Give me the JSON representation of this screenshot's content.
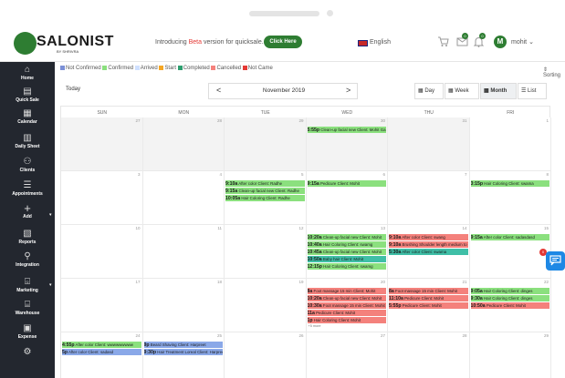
{
  "header": {
    "logo": "SALONIST",
    "logo_sub": "BY SHRIVRA",
    "intro_pre": "Introducing ",
    "intro_beta": "Beta",
    "intro_post": " version for quicksale.",
    "click_here": "Click Here",
    "language": "English",
    "notif_badge_1": "0",
    "notif_badge_2": "0",
    "avatar_letter": "M",
    "user_name": "mohit"
  },
  "sidebar": {
    "items": [
      {
        "label": "Home",
        "icon": "home-icon",
        "glyph": "⌂"
      },
      {
        "label": "Quick Sale",
        "icon": "register-icon",
        "glyph": "▤"
      },
      {
        "label": "Calendar",
        "icon": "calendar-icon",
        "glyph": "▦"
      },
      {
        "label": "Daily Sheet",
        "icon": "sheet-icon",
        "glyph": "▥"
      },
      {
        "label": "Clients",
        "icon": "clients-icon",
        "glyph": "⚇"
      },
      {
        "label": "Appointments",
        "icon": "list-icon",
        "glyph": "☰"
      },
      {
        "label": "Add",
        "icon": "plus-icon",
        "glyph": "+"
      },
      {
        "label": "Reports",
        "icon": "report-icon",
        "glyph": "▧"
      },
      {
        "label": "Integration",
        "icon": "integration-icon",
        "glyph": "⚲"
      },
      {
        "label": "Marketing",
        "icon": "marketing-icon",
        "glyph": "⌺"
      },
      {
        "label": "Warehouse",
        "icon": "warehouse-icon",
        "glyph": "⌸"
      },
      {
        "label": "Expense",
        "icon": "expense-icon",
        "glyph": "▣"
      },
      {
        "label": "",
        "icon": "settings-icon",
        "glyph": "⚙"
      }
    ]
  },
  "legend": {
    "items": [
      {
        "label": "Not Confirmed",
        "color": "#7b8fd6"
      },
      {
        "label": "Confirmed",
        "color": "#8be07e"
      },
      {
        "label": "Arrived",
        "color": "#cfe0ff"
      },
      {
        "label": "Start",
        "color": "#f5a623"
      },
      {
        "label": "Completed",
        "color": "#2e9e6f"
      },
      {
        "label": "Cancelled",
        "color": "#f4817c"
      },
      {
        "label": "Not Came",
        "color": "#e53935"
      }
    ],
    "sorting": "⇕ Sorting"
  },
  "toolbar": {
    "today": "Today",
    "prev": "<",
    "month": "November 2019",
    "next": ">",
    "views": [
      "Day",
      "Week",
      "Month",
      "List"
    ],
    "active_view": "Month"
  },
  "calendar": {
    "days_of_week": [
      "SUN",
      "MON",
      "TUE",
      "WED",
      "THU",
      "FRI"
    ],
    "weeks": [
      [
        {
          "day": "27",
          "past": true,
          "events": []
        },
        {
          "day": "28",
          "past": true,
          "events": []
        },
        {
          "day": "29",
          "past": true,
          "events": []
        },
        {
          "day": "30",
          "past": true,
          "events": [
            {
              "time": "5:55p",
              "text": "Clean-up facial new Client: Mohit Ga",
              "color": "green"
            }
          ]
        },
        {
          "day": "31",
          "past": true,
          "events": []
        },
        {
          "day": "1",
          "past": false,
          "events": []
        }
      ],
      [
        {
          "day": "3",
          "past": false,
          "events": []
        },
        {
          "day": "4",
          "past": false,
          "events": []
        },
        {
          "day": "5",
          "past": false,
          "events": [
            {
              "time": "9:10a",
              "text": "After color Client: Radhe",
              "color": "green"
            },
            {
              "time": "9:15a",
              "text": "Clean-up facial new Client: Radhe",
              "color": "green"
            },
            {
              "time": "10:05a",
              "text": "Hair Coloring Client: Radhe",
              "color": "green"
            }
          ]
        },
        {
          "day": "6",
          "past": false,
          "events": [
            {
              "time": "9:15a",
              "text": "Pedicure Client: Mohit",
              "color": "green"
            }
          ]
        },
        {
          "day": "7",
          "past": false,
          "events": []
        },
        {
          "day": "8",
          "past": false,
          "events": [
            {
              "time": "3:15p",
              "text": "Hair Coloring Client: swama",
              "color": "green"
            }
          ]
        }
      ],
      [
        {
          "day": "10",
          "past": false,
          "events": []
        },
        {
          "day": "11",
          "past": false,
          "events": []
        },
        {
          "day": "12",
          "past": false,
          "events": []
        },
        {
          "day": "13",
          "past": false,
          "events": [
            {
              "time": "10:20a",
              "text": "Clean-up facial new Client: Mohit",
              "color": "green"
            },
            {
              "time": "10:40a",
              "text": "Hair Coloring Client: swamg",
              "color": "green"
            },
            {
              "time": "10:45a",
              "text": "Clean-up facial new Client: Mohit",
              "color": "green"
            },
            {
              "time": "10:50a",
              "text": "Baby hair Client: Mohit",
              "color": "teal"
            },
            {
              "time": "12:15p",
              "text": "Hair Coloring Client: swamg",
              "color": "green"
            }
          ]
        },
        {
          "day": "14",
          "past": false,
          "events": [
            {
              "time": "9:10a",
              "text": "After color Client: swang",
              "color": "red"
            },
            {
              "time": "9:10a",
              "text": "Brushing Shoulder length medium to",
              "color": "red"
            },
            {
              "time": "5:30a",
              "text": "After color Client: swama",
              "color": "teal"
            }
          ]
        },
        {
          "day": "15",
          "past": false,
          "events": [
            {
              "time": "9:15a",
              "text": "After color Client: sadasdasd",
              "color": "green"
            }
          ]
        }
      ],
      [
        {
          "day": "17",
          "past": false,
          "events": []
        },
        {
          "day": "18",
          "past": false,
          "events": []
        },
        {
          "day": "19",
          "past": false,
          "events": []
        },
        {
          "day": "20",
          "past": false,
          "events": [
            {
              "time": "8a",
              "text": "Foot massage 15 min Client: Mohit",
              "color": "red"
            },
            {
              "time": "10:20a",
              "text": "Clean-up facial new Client: Mohit",
              "color": "red"
            },
            {
              "time": "10:30a",
              "text": "Foot massage 15 min Client: Mohit",
              "color": "red"
            },
            {
              "time": "11a",
              "text": "Pedicure Client: Mohit",
              "color": "red"
            },
            {
              "time": "1p",
              "text": "Hair Coloring Client: Mohit",
              "color": "red"
            }
          ],
          "more": "+5 more"
        },
        {
          "day": "21",
          "past": false,
          "events": [
            {
              "time": "8a",
              "text": "Foot massage 15 min Client: Mohit",
              "color": "red"
            },
            {
              "time": "11:10a",
              "text": "Pedicure Client: Mohit",
              "color": "red"
            },
            {
              "time": "5:55p",
              "text": "Pedicure Client: Mohit",
              "color": "red"
            }
          ]
        },
        {
          "day": "22",
          "past": false,
          "events": [
            {
              "time": "9:05a",
              "text": "Hair Coloring Client: dinges",
              "color": "green"
            },
            {
              "time": "9:30a",
              "text": "Hair Coloring Client: dinges",
              "color": "green"
            },
            {
              "time": "10:50a",
              "text": "Pedicure Client: Mohit",
              "color": "red"
            }
          ]
        }
      ],
      [
        {
          "day": "24",
          "past": false,
          "events": [
            {
              "time": "4:55p",
              "text": "After color Client: wwwwwwwww",
              "color": "green"
            },
            {
              "time": "5p",
              "text": "After color Client: sadasd",
              "color": "blue"
            }
          ]
        },
        {
          "day": "25",
          "past": false,
          "events": [
            {
              "time": "9p",
              "text": "Beard Shaving Client: Harpreet",
              "color": "blue"
            },
            {
              "time": "9:30p",
              "text": "Hair Treatment Loreal Client: Harpree",
              "color": "blue"
            }
          ]
        },
        {
          "day": "26",
          "past": false,
          "events": []
        },
        {
          "day": "27",
          "past": false,
          "events": []
        },
        {
          "day": "28",
          "past": false,
          "events": []
        },
        {
          "day": "29",
          "past": false,
          "events": []
        }
      ]
    ]
  },
  "chat": {
    "badge": "0",
    "icon": "chat-icon"
  }
}
